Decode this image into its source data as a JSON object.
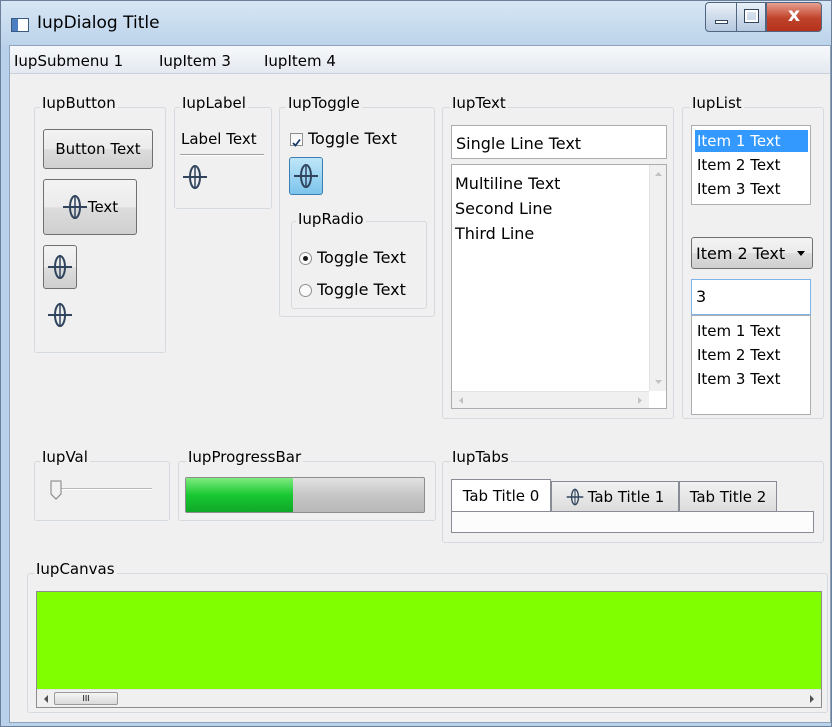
{
  "window": {
    "title": "IupDialog Title",
    "controls": {
      "close_label": "x"
    }
  },
  "menu": {
    "items": [
      {
        "label": "IupSubmenu 1"
      },
      {
        "label": "IupItem 3"
      },
      {
        "label": "IupItem 4"
      }
    ]
  },
  "button_frame": {
    "title": "IupButton",
    "button_text": "Button Text",
    "image_button_text": "Text"
  },
  "label_frame": {
    "title": "IupLabel",
    "label_text": "Label Text"
  },
  "toggle_frame": {
    "title": "IupToggle",
    "toggle_text": "Toggle Text",
    "toggle_checked": true,
    "radio": {
      "title": "IupRadio",
      "options": [
        {
          "label": "Toggle Text",
          "selected": true
        },
        {
          "label": "Toggle Text",
          "selected": false
        }
      ]
    }
  },
  "text_frame": {
    "title": "IupText",
    "single_line": "Single Line Text",
    "multiline": {
      "lines": [
        "Multiline Text",
        "Second Line",
        "Third Line"
      ]
    }
  },
  "list_frame": {
    "title": "IupList",
    "list1": {
      "items": [
        "Item 1 Text",
        "Item 2 Text",
        "Item 3 Text"
      ],
      "selected": "Item 1 Text"
    },
    "dropdown": {
      "value": "Item 2 Text"
    },
    "edit_box": {
      "value": "3",
      "items": [
        "Item 1 Text",
        "Item 2 Text",
        "Item 3 Text"
      ]
    }
  },
  "val_frame": {
    "title": "IupVal",
    "value": 0
  },
  "progress_frame": {
    "title": "IupProgressBar",
    "value": 0.45
  },
  "tabs_frame": {
    "title": "IupTabs",
    "tabs": [
      {
        "label": "Tab Title 0"
      },
      {
        "label": "Tab Title 1"
      },
      {
        "label": "Tab Title 2"
      }
    ],
    "active": 0
  },
  "canvas_frame": {
    "title": "IupCanvas",
    "color": "#7fff00",
    "scroll_thumb": "III"
  },
  "colors": {
    "accent": "#3399ff",
    "canvas": "#7fff00",
    "progress": "#19c832",
    "close": "#c0422a"
  }
}
